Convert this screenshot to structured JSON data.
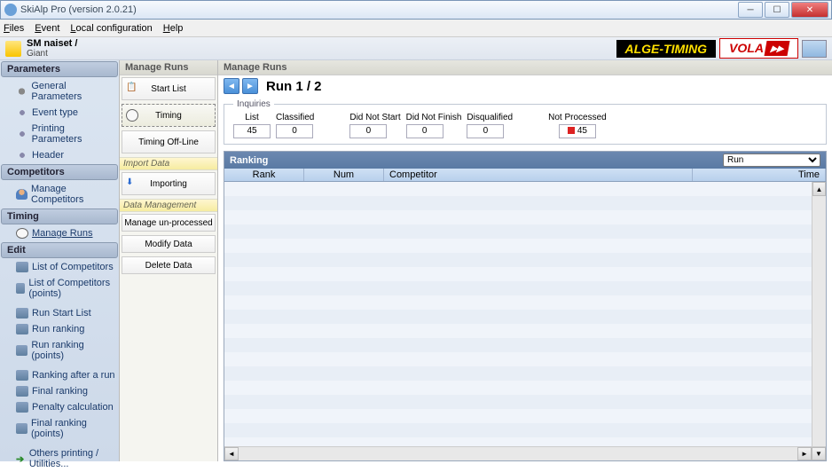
{
  "window": {
    "title": "SkiAlp Pro (version 2.0.21)"
  },
  "menu": {
    "files": "Files",
    "event": "Event",
    "local": "Local configuration",
    "help": "Help"
  },
  "doc": {
    "title": "SM naiset /",
    "subtitle": "Giant"
  },
  "brands": {
    "b1": "ALGE-TIMING",
    "b2": "VOLA"
  },
  "sidebar": {
    "parameters": {
      "h": "Parameters",
      "items": [
        "General Parameters",
        "Event type",
        "Printing Parameters",
        "Header"
      ]
    },
    "competitors": {
      "h": "Competitors",
      "items": [
        "Manage Competitors"
      ]
    },
    "timing": {
      "h": "Timing",
      "items": [
        "Manage Runs"
      ]
    },
    "edit": {
      "h": "Edit",
      "items1": [
        "List of Competitors",
        "List of Competitors (points)"
      ],
      "items2": [
        "Run Start List",
        "Run ranking",
        "Run ranking (points)"
      ],
      "items3": [
        "Ranking after a run",
        "Final ranking",
        "Penalty calculation",
        "Final ranking (points)"
      ],
      "items4": [
        "Others printing / Utilities..."
      ]
    }
  },
  "center": {
    "title": "Manage Runs",
    "buttons": [
      "Start List",
      "Timing",
      "Timing Off-Line"
    ],
    "import_h": "Import Data",
    "import_btn": "Importing",
    "mgmt_h": "Data Management",
    "mgmt": [
      "Manage un-processed",
      "Modify Data",
      "Delete Data"
    ]
  },
  "content": {
    "run_title": "Run 1 / 2",
    "inquiries_legend": "Inquiries",
    "inq": {
      "list_lbl": "List",
      "list_val": "45",
      "classified_lbl": "Classified",
      "classified_val": "0",
      "dns_lbl": "Did Not Start",
      "dns_val": "0",
      "dnf_lbl": "Did Not Finish",
      "dnf_val": "0",
      "dsq_lbl": "Disqualified",
      "dsq_val": "0",
      "np_lbl": "Not Processed",
      "np_val": "45"
    },
    "ranking": {
      "title": "Ranking",
      "dropdown": "Run",
      "cols": {
        "rank": "Rank",
        "num": "Num",
        "comp": "Competitor",
        "time": "Time"
      }
    }
  }
}
